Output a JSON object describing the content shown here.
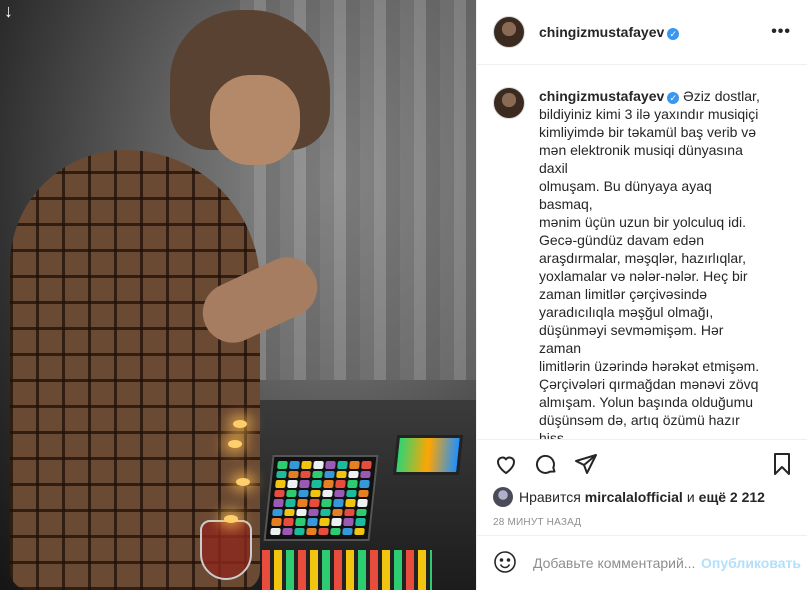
{
  "photo": {
    "alt_icon": "down-arrow-icon",
    "arrow_glyph": "↓"
  },
  "post": {
    "username": "chingizmustafayev",
    "verified": true,
    "more_glyph": "•••",
    "caption_username": "chingizmustafayev",
    "caption": "Əziz dostlar,\nbildiyiniz kimi 3 ilə yaxındır musiqiçi\nkimliyimdə bir təkamül baş verib və\nmən elektronik musiqi dünyasına daxil\nolmuşam. Bu dünyaya ayaq basmaq,\nmənim üçün uzun bir yolculuq idi.\nGecə-gündüz davam edən\naraşdırmalar, məşqlər, hazırlıqlar,\nyoxlamalar və nələr-nələr. Heç bir\nzaman limitlər çərçivəsində\nyaradıcılıqla məşğul olmağı,\ndüşünməyi sevməmişəm. Hər zaman\nlimitlərin üzərində hərəkət etmişəm.\nÇərçivələri qırmağdan mənəvi zövq\nalmışam. Yolun başında olduğumu\ndüşünsəm də, artıq özümü hazır hiss\nedirəm.\n“Elektronik musiqiçi” kimi artıq\nqarşınızdayam və sizlərə yeni səhnə"
  },
  "likes": {
    "prefix": "Нравится",
    "liker": "mircalalofficial",
    "conjunction": "и",
    "others": "ещё 2 212"
  },
  "timestamp": "28 МИНУТ НАЗАД",
  "comment_box": {
    "placeholder": "Добавьте комментарий...",
    "post_label": "Опубликовать"
  },
  "colors": {
    "verified": "#3897f0",
    "post_button_disabled": "#b2dffc",
    "muted_text": "#8e8e8e"
  }
}
